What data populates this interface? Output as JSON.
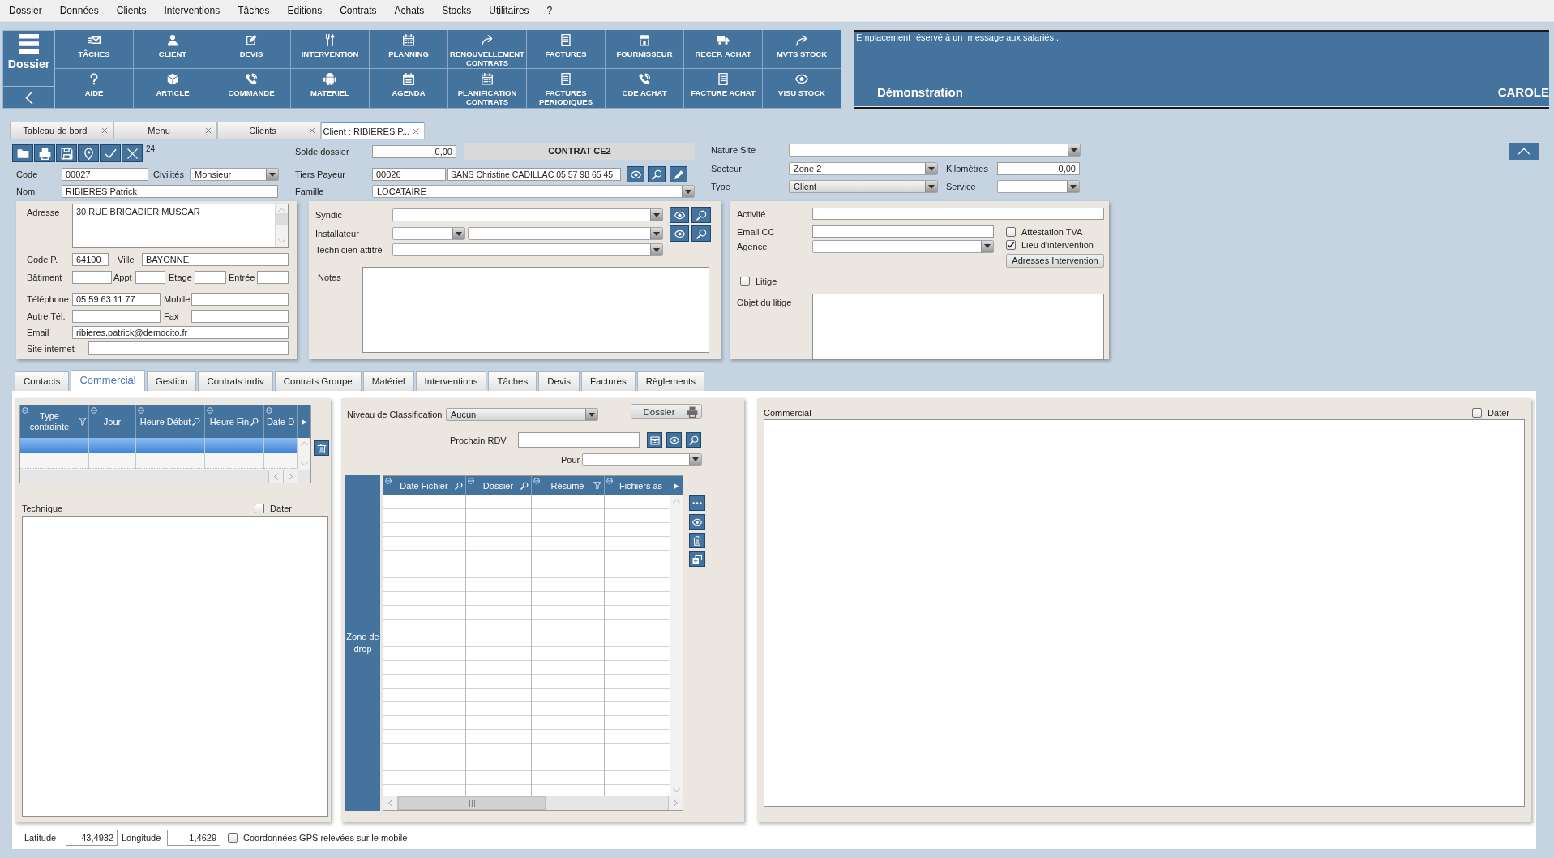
{
  "menu_bar": [
    "Dossier",
    "Données",
    "Clients",
    "Interventions",
    "Tâches",
    "Editions",
    "Contrats",
    "Achats",
    "Stocks",
    "Utilitaires",
    "?"
  ],
  "toolbar": {
    "home_label": "Dossier",
    "buttons": [
      {
        "label": "TÂCHES",
        "kind": "tasks"
      },
      {
        "label": "CLIENT",
        "kind": "client"
      },
      {
        "label": "DEVIS",
        "kind": "quote"
      },
      {
        "label": "INTERVENTION",
        "kind": "tools"
      },
      {
        "label": "PLANNING",
        "kind": "calendar"
      },
      {
        "label": "RENOUVELLEMENT CONTRATS",
        "kind": "forward"
      },
      {
        "label": "FACTURES",
        "kind": "document"
      },
      {
        "label": "FOURNISSEUR",
        "kind": "shop"
      },
      {
        "label": "RECEP. ACHAT",
        "kind": "truck"
      },
      {
        "label": "MVTS STOCK",
        "kind": "forward"
      },
      {
        "label": "AIDE",
        "kind": "help"
      },
      {
        "label": "ARTICLE",
        "kind": "cube"
      },
      {
        "label": "COMMANDE",
        "kind": "phone"
      },
      {
        "label": "MATERIEL",
        "kind": "robot"
      },
      {
        "label": "AGENDA",
        "kind": "agenda"
      },
      {
        "label": "PLANIFICATION CONTRATS",
        "kind": "calendar"
      },
      {
        "label": "FACTURES PERIODIQUES",
        "kind": "document"
      },
      {
        "label": "CDE ACHAT",
        "kind": "phone"
      },
      {
        "label": "FACTURE ACHAT",
        "kind": "document"
      },
      {
        "label": "VISU STOCK",
        "kind": "eye"
      }
    ]
  },
  "message_panel": {
    "message": "Emplacement réservé à un  message aux salariés...",
    "company": "Démonstration",
    "user": "CAROLE"
  },
  "document_tabs": [
    {
      "label": "Tableau de bord",
      "selected": false
    },
    {
      "label": "Menu",
      "selected": false
    },
    {
      "label": "Clients",
      "selected": false
    },
    {
      "label": "Client : RIBIERES P...",
      "selected": true
    }
  ],
  "record": {
    "count": "24",
    "code": {
      "label": "Code",
      "value": "00027"
    },
    "civilite": {
      "label": "Civilités",
      "value": "Monsieur"
    },
    "nom": {
      "label": "Nom",
      "value": "RIBIERES Patrick"
    },
    "solde": {
      "label": "Solde dossier",
      "value": "0,00"
    },
    "contract_banner": "CONTRAT CE2",
    "tiers_payeur": {
      "label": "Tiers Payeur",
      "code": "00026",
      "name": "SANS Christine CADILLAC 05 57 98 65 45"
    },
    "famille": {
      "label": "Famille",
      "value": "LOCATAIRE"
    },
    "nature_site": {
      "label": "Nature Site"
    },
    "secteur": {
      "label": "Secteur",
      "value": "Zone 2"
    },
    "kilometres": {
      "label": "Kilomètres",
      "value": "0,00"
    },
    "type": {
      "label": "Type",
      "value": "Client",
      "kind": "select"
    },
    "service": {
      "label": "Service"
    }
  },
  "address": {
    "adresse": {
      "label": "Adresse",
      "value": "30 RUE BRIGADIER MUSCAR"
    },
    "code_postal": {
      "label": "Code P.",
      "value": "64100"
    },
    "ville": {
      "label": "Ville",
      "value": "BAYONNE"
    },
    "batiment": {
      "label": "Bâtiment"
    },
    "appt": {
      "label": "Appt"
    },
    "etage": {
      "label": "Etage"
    },
    "entree": {
      "label": "Entrée"
    },
    "telephone": {
      "label": "Téléphone",
      "value": "05 59 63 11 77"
    },
    "mobile": {
      "label": "Mobile"
    },
    "autre_tel": {
      "label": "Autre Tél."
    },
    "fax": {
      "label": "Fax"
    },
    "email": {
      "label": "Email",
      "value": "ribieres.patrick@democito.fr"
    },
    "site": {
      "label": "Site internet"
    }
  },
  "contacts": {
    "syndic": {
      "label": "Syndic"
    },
    "installateur": {
      "label": "Installateur"
    },
    "technicien": {
      "label": "Technicien attitré"
    },
    "notes": {
      "label": "Notes"
    }
  },
  "details": {
    "activite": {
      "label": "Activité"
    },
    "email_cc": {
      "label": "Email CC"
    },
    "agence": {
      "label": "Agence"
    },
    "attestation_tva": {
      "label": "Attestation TVA",
      "checked": false
    },
    "lieu_intervention": {
      "label": "Lieu d'intervention",
      "checked": true
    },
    "adresses_button": "Adresses Intervention",
    "litige": {
      "label": "Litige",
      "checked": false
    },
    "objet_litige": {
      "label": "Objet du litige"
    }
  },
  "section_tabs": [
    {
      "label": "Contacts",
      "selected": false
    },
    {
      "label": "Commercial",
      "selected": true
    },
    {
      "label": "Gestion",
      "selected": false
    },
    {
      "label": "Contrats indiv",
      "selected": false
    },
    {
      "label": "Contrats Groupe",
      "selected": false
    },
    {
      "label": "Matériel",
      "selected": false
    },
    {
      "label": "Interventions",
      "selected": false
    },
    {
      "label": "Tâches",
      "selected": false
    },
    {
      "label": "Devis",
      "selected": false
    },
    {
      "label": "Factures",
      "selected": false
    },
    {
      "label": "Règlements",
      "selected": false
    }
  ],
  "constraints_table": {
    "columns": [
      {
        "label": "Type contrainte",
        "kind": "filter"
      },
      {
        "label": "Jour",
        "kind": "plain"
      },
      {
        "label": "Heure Début",
        "kind": "search"
      },
      {
        "label": "Heure Fin",
        "kind": "search"
      },
      {
        "label": "Date D",
        "kind": "plain"
      }
    ],
    "rows": [
      {
        "selected": true
      },
      {
        "selected": false
      }
    ]
  },
  "technique": {
    "label": "Technique",
    "dater": {
      "label": "Dater",
      "checked": false
    }
  },
  "documents": {
    "classification": {
      "label": "Niveau de Classification",
      "value": "Aucun",
      "kind": "select"
    },
    "dossier_button": "Dossier",
    "prochain_rdv": {
      "label": "Prochain RDV"
    },
    "pour": {
      "label": "Pour"
    },
    "drop_zone": "Zone de drop",
    "columns": [
      {
        "label": "Date Fichier",
        "kind": "search"
      },
      {
        "label": "Dossier",
        "kind": "search"
      },
      {
        "label": "Résumé",
        "kind": "filter"
      },
      {
        "label": "Fichiers as",
        "kind": "plain"
      }
    ]
  },
  "commercial_notes": {
    "label": "Commercial",
    "dater": {
      "label": "Dater",
      "checked": false
    }
  },
  "gps": {
    "latitude": {
      "label": "Latitude",
      "value": "43,4932"
    },
    "longitude": {
      "label": "Longitude",
      "value": "-1,4629"
    },
    "mobile_gps": {
      "label": "Coordonnées GPS relevées sur le mobile",
      "checked": false
    }
  }
}
